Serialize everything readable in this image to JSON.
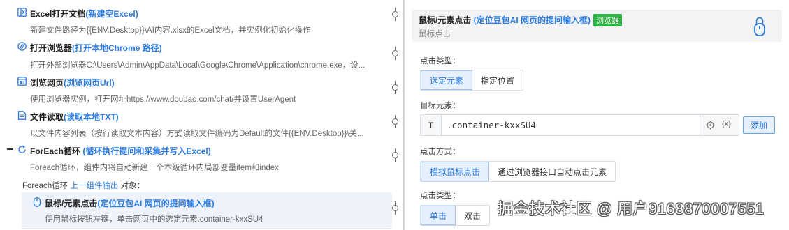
{
  "steps": [
    {
      "title": "Excel打开文档",
      "hint": "(新建空Excel)",
      "desc": "新建文件路径为{{ENV.Desktop}}\\AI内容.xlsx的Excel文档，并实例化初始化操作",
      "icon": "excel-doc-icon"
    },
    {
      "title": "打开浏览器",
      "hint": "(打开本地Chrome 路径)",
      "desc": "打开外部浏览器C:\\Users\\Admin\\AppData\\Local\\Google\\Chrome\\Application\\chrome.exe，设...",
      "icon": "browser-icon"
    },
    {
      "title": "浏览网页",
      "hint": "(浏览网页Url)",
      "desc": "使用浏览器实例，打开网址https://www.doubao.com/chat/并设置UserAgent",
      "icon": "webpage-icon"
    },
    {
      "title": "文件读取",
      "hint": "(读取本地TXT)",
      "desc": "以文件内容列表（按行读取文本内容）方式读取文件编码为Default的文件{{ENV.Desktop}}\\关...",
      "icon": "file-read-icon"
    },
    {
      "title": "ForEach循环",
      "hint": " (循环执行提问和采集并写入Excel)",
      "desc": "Foreach循环，组件内将自动新建一个本级循环内局部变量item和index",
      "icon": "loop-icon"
    }
  ],
  "loop_sub": {
    "prefix": "Foreach循环 ",
    "link": "上一组件输出",
    "suffix": " 对象："
  },
  "sub_step": {
    "title": "鼠标/元素点击",
    "hint": "(定位豆包AI 网页的提问输入框)",
    "desc": "使用鼠标按钮左键，单击网页中的选定元素.container-kxxSU4",
    "icon": "mouse-icon"
  },
  "panel": {
    "title": "鼠标/元素点击",
    "hint": " (定位豆包AI 网页的提问输入框)",
    "badge": "浏览器",
    "subtitle": "鼠标点击",
    "click_type_label": "点击类型：",
    "click_type_options": [
      "选定元素",
      "指定位置"
    ],
    "target_label": "目标元素：",
    "target_prefix": "T",
    "target_value": ".container-kxxSU4",
    "var_label": "{x}",
    "add_label": "添加",
    "click_mode_label": "点击方式：",
    "click_mode_options": [
      "模拟鼠标点击",
      "通过浏览器接口自动点击元素"
    ],
    "click_kind_label": "点击类型：",
    "click_kind_options": [
      "单击",
      "双击"
    ]
  },
  "watermark": "掘金技术社区 @ 用户9168870007551",
  "colors": {
    "accent": "#2b7be0",
    "badge": "#2fb344"
  }
}
